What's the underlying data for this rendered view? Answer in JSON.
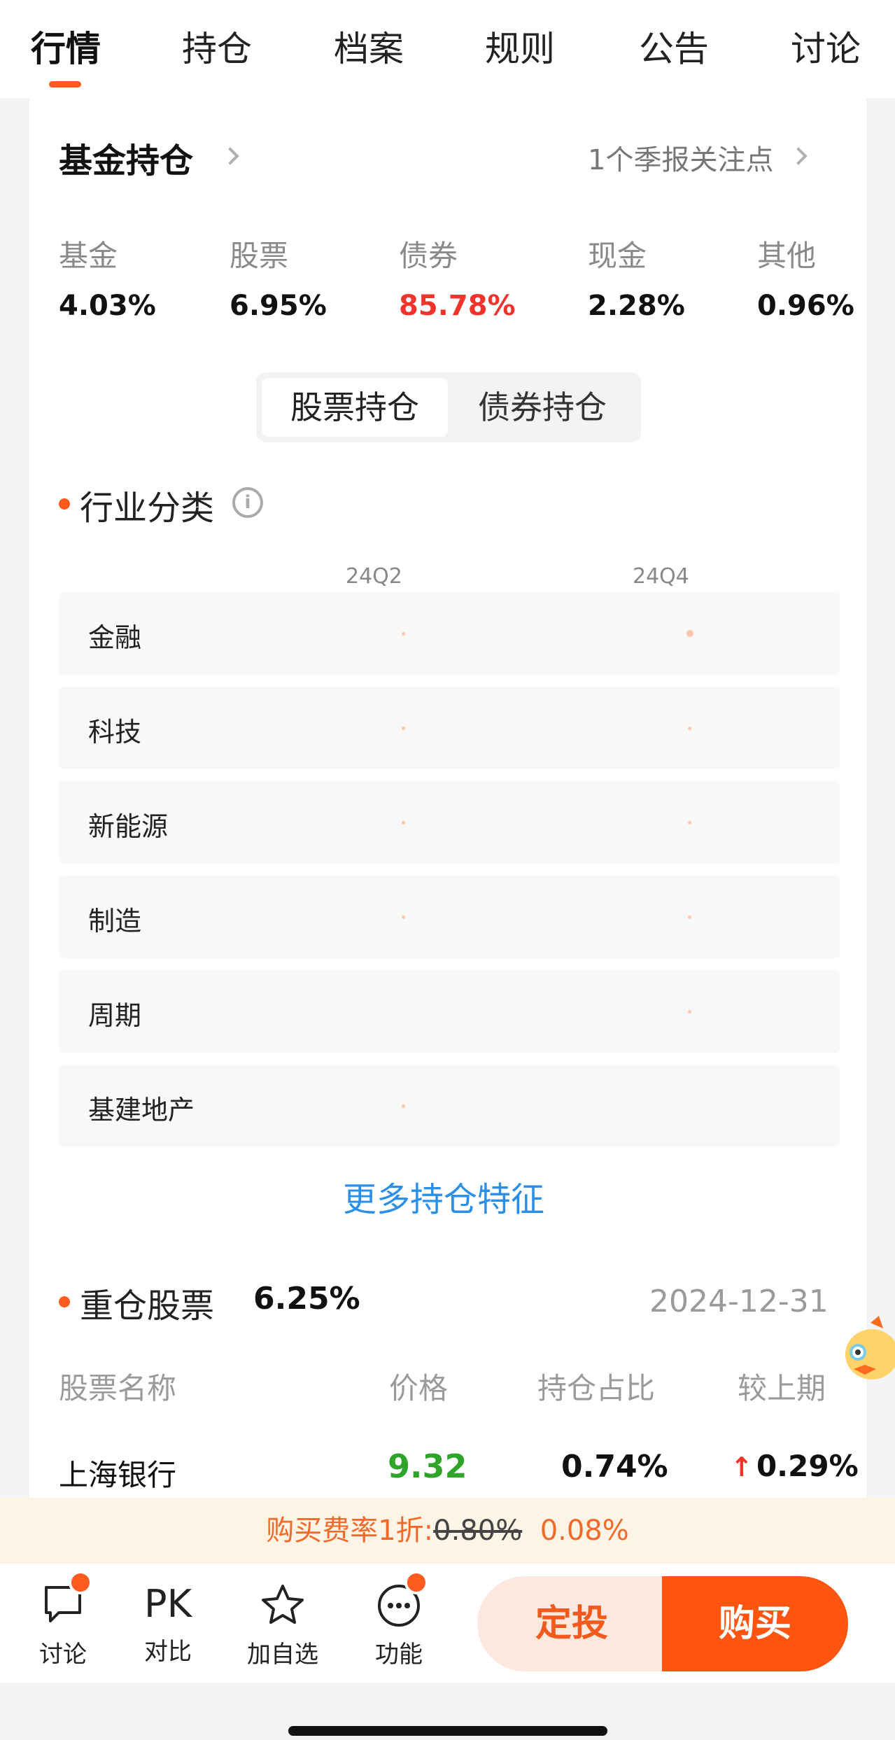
{
  "tabs": [
    {
      "label": "行情",
      "active": true
    },
    {
      "label": "持仓",
      "active": false
    },
    {
      "label": "档案",
      "active": false
    },
    {
      "label": "规则",
      "active": false
    },
    {
      "label": "公告",
      "active": false
    },
    {
      "label": "讨论",
      "active": false
    }
  ],
  "holdings": {
    "title": "基金持仓",
    "quarter_note": "1个季报关注点",
    "allocation": [
      {
        "label": "基金",
        "value": "4.03%"
      },
      {
        "label": "股票",
        "value": "6.95%"
      },
      {
        "label": "债券",
        "value": "85.78%"
      },
      {
        "label": "现金",
        "value": "2.28%"
      },
      {
        "label": "其他",
        "value": "0.96%"
      }
    ],
    "segment": {
      "stock": "股票持仓",
      "bond": "债券持仓"
    }
  },
  "industry": {
    "title": "行业分类",
    "info_icon": "info-icon",
    "periods": [
      "24Q2",
      "24Q4"
    ],
    "rows": [
      "金融",
      "科技",
      "新能源",
      "制造",
      "周期",
      "基建地产"
    ]
  },
  "more_link": "更多持仓特征",
  "heavy": {
    "title": "重仓股票",
    "pct": "6.25%",
    "date": "2024-12-31",
    "headers": {
      "name": "股票名称",
      "price": "价格",
      "ratio": "持仓占比",
      "change": "较上期"
    },
    "rows": [
      {
        "name": "上海银行",
        "price": "9.32",
        "ratio": "0.74%",
        "change": "0.29%"
      }
    ]
  },
  "fee": {
    "prefix": "购买费率1折:",
    "original": "0.80%",
    "discounted": "0.08%"
  },
  "bottom": {
    "discuss": "讨论",
    "pk_icon_text": "PK",
    "compare": "对比",
    "watch": "加自选",
    "func": "功能",
    "dingtou": "定投",
    "buy": "购买"
  },
  "colors": {
    "accent": "#ff5a1f",
    "red": "#f0342c",
    "green": "#2ea52a",
    "link": "#2b8fe8"
  }
}
